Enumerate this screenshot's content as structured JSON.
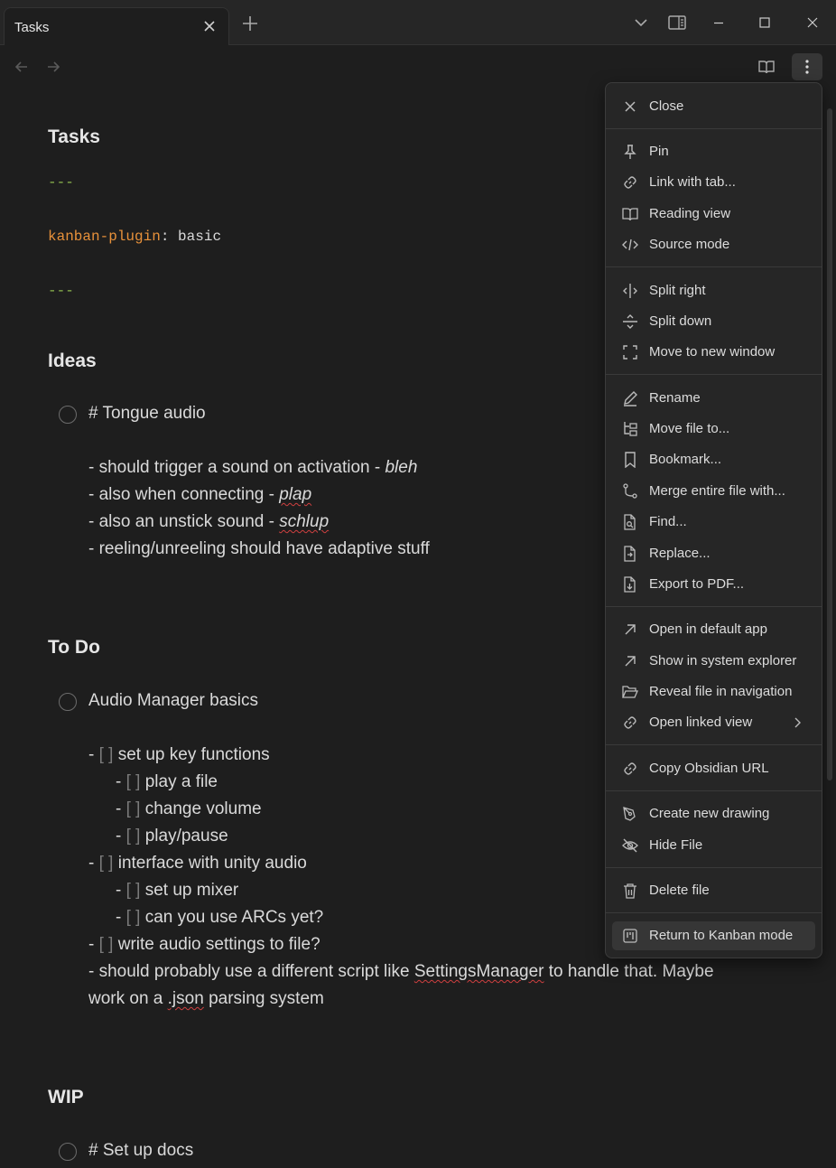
{
  "tab": {
    "title": "Tasks"
  },
  "frontmatter": {
    "dashes": "---",
    "key": "kanban-plugin",
    "colon": ":",
    "value": " basic"
  },
  "note_title": "Tasks",
  "sections": {
    "ideas": {
      "heading": "Ideas",
      "card_title": "# Tongue audio",
      "lines": [
        {
          "text": "- should trigger a sound on activation - ",
          "em": "bleh"
        },
        {
          "text": "- also when connecting - ",
          "em": "plap"
        },
        {
          "text": "- also an unstick sound - ",
          "em": "schlup"
        },
        {
          "text": "- reeling/unreeling should have adaptive stuff"
        }
      ]
    },
    "todo": {
      "heading": "To Do",
      "card_title": "Audio Manager basics",
      "items": [
        "set up key functions",
        "play a file",
        "change volume",
        "play/pause",
        "interface with unity audio",
        "set up mixer",
        "can you use ARCs yet?",
        "write audio settings to file?"
      ],
      "note_line1_a": "- should probably use a different script like ",
      "note_line1_b": "SettingsManager",
      "note_line1_c": " to handle that. Maybe",
      "note_line2_a": "work on a ",
      "note_line2_b": ".json",
      "note_line2_c": " parsing system"
    },
    "wip": {
      "heading": "WIP",
      "card_title": "# Set up docs"
    }
  },
  "checkbox_glyph": "[ ]",
  "dash": "-",
  "menu": {
    "items": [
      {
        "label": "Close",
        "icon": "close-icon"
      },
      {
        "label": "Pin",
        "icon": "pin-icon"
      },
      {
        "label": "Link with tab...",
        "icon": "link-icon"
      },
      {
        "label": "Reading view",
        "icon": "book-open-icon"
      },
      {
        "label": "Source mode",
        "icon": "code-icon"
      },
      {
        "label": "Split right",
        "icon": "split-vertical-icon"
      },
      {
        "label": "Split down",
        "icon": "split-horizontal-icon"
      },
      {
        "label": "Move to new window",
        "icon": "maximize-icon"
      },
      {
        "label": "Rename",
        "icon": "pencil-icon"
      },
      {
        "label": "Move file to...",
        "icon": "folder-tree-icon"
      },
      {
        "label": "Bookmark...",
        "icon": "bookmark-icon"
      },
      {
        "label": "Merge entire file with...",
        "icon": "git-merge-icon"
      },
      {
        "label": "Find...",
        "icon": "file-search-icon"
      },
      {
        "label": "Replace...",
        "icon": "file-replace-icon"
      },
      {
        "label": "Export to PDF...",
        "icon": "file-download-icon"
      },
      {
        "label": "Open in default app",
        "icon": "arrow-up-right-icon"
      },
      {
        "label": "Show in system explorer",
        "icon": "arrow-up-right-icon"
      },
      {
        "label": "Reveal file in navigation",
        "icon": "folder-open-icon"
      },
      {
        "label": "Open linked view",
        "icon": "link-icon"
      },
      {
        "label": "Copy Obsidian URL",
        "icon": "link-icon"
      },
      {
        "label": "Create new drawing",
        "icon": "pen-tool-icon"
      },
      {
        "label": "Hide File",
        "icon": "eye-off-icon"
      },
      {
        "label": "Delete file",
        "icon": "trash-icon"
      },
      {
        "label": "Return to Kanban mode",
        "icon": "kanban-icon"
      }
    ]
  },
  "colors": {
    "background": "#1e1e1e",
    "menu_bg": "#262626",
    "yaml_dash": "#8fb84e",
    "yaml_key": "#e8913a",
    "spellcheck": "#d04040"
  }
}
